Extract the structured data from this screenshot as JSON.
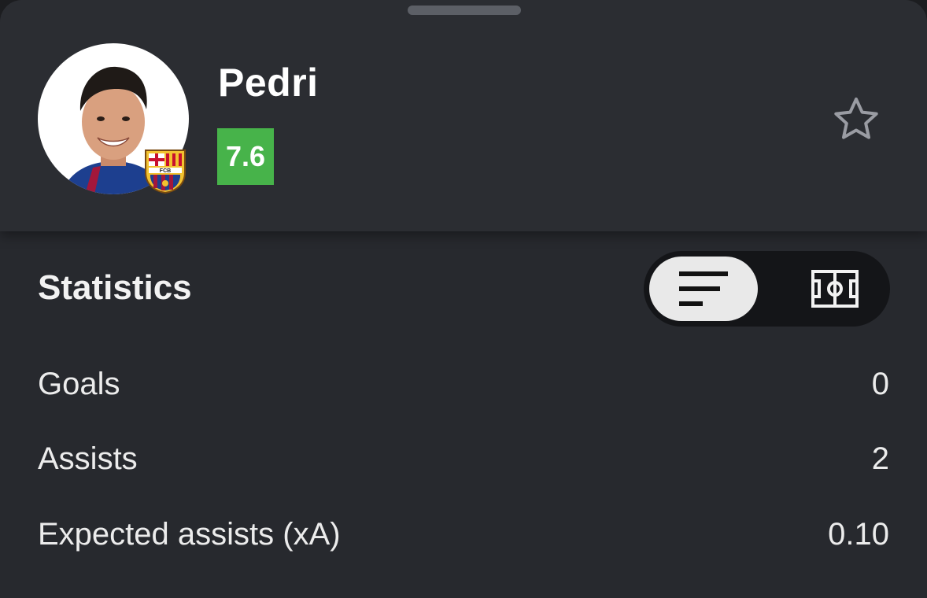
{
  "player": {
    "name": "Pedri",
    "rating": "7.6",
    "rating_color": "#47b34a",
    "club_badge_text": "FCB"
  },
  "icons": {
    "favorite": "star-outline-icon",
    "list_view": "list-icon",
    "pitch_view": "pitch-icon"
  },
  "statistics": {
    "title": "Statistics",
    "rows": [
      {
        "label": "Goals",
        "value": "0"
      },
      {
        "label": "Assists",
        "value": "2"
      },
      {
        "label": "Expected assists (xA)",
        "value": "0.10"
      }
    ]
  }
}
